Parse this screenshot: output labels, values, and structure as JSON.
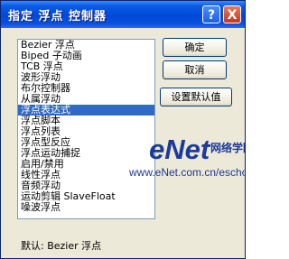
{
  "window": {
    "title": "指定 浮点 控制器",
    "help_button": "?",
    "close_button": "X"
  },
  "list": {
    "items": [
      "Bezier 浮点",
      "Biped 子动画",
      "TCB 浮点",
      "波形浮动",
      "布尔控制器",
      "从属浮动",
      "浮点表达式",
      "浮点脚本",
      "浮点列表",
      "浮点型反应",
      "浮点运动捕捉",
      "启用/禁用",
      "线性浮点",
      "音频浮动",
      "运动剪辑 SlaveFloat",
      "噪波浮点"
    ],
    "selected_index": 6
  },
  "buttons": {
    "ok": "确定",
    "cancel": "取消",
    "set_default": "设置默认值"
  },
  "status": {
    "default_label": "默认: Bezier 浮点"
  },
  "watermark": {
    "logo": "eNet",
    "chinese": "网络学院",
    "url": "www.eNet.com.cn/eschool"
  }
}
